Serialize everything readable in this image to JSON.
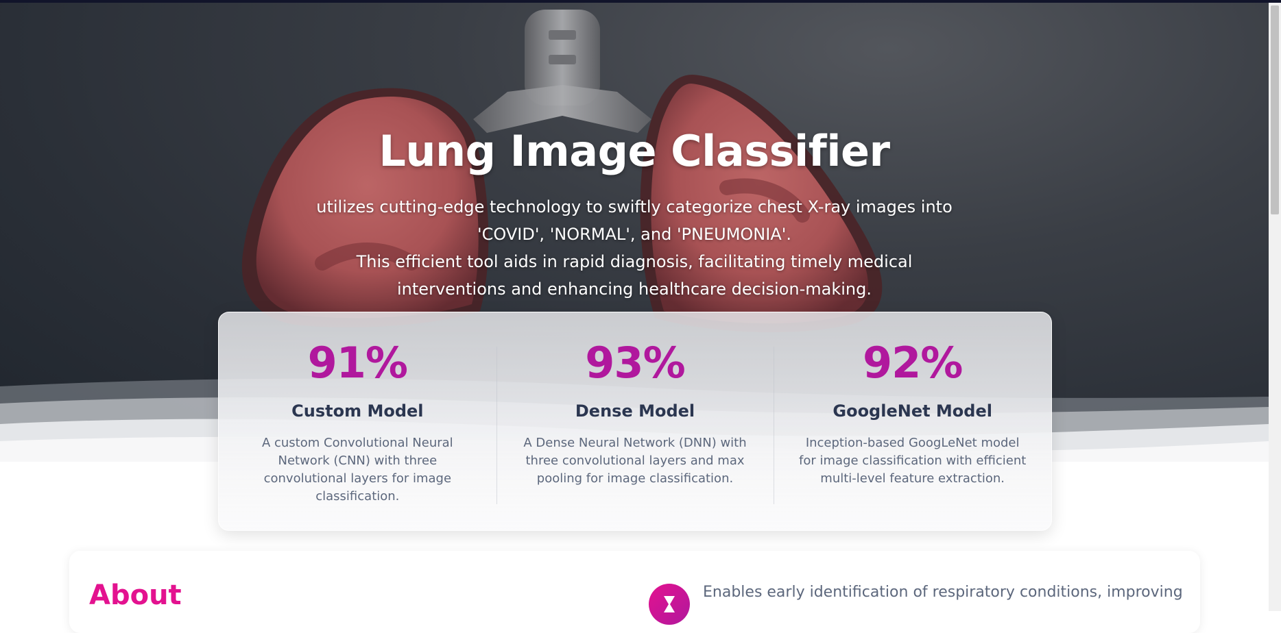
{
  "hero": {
    "title": "Lung Image Classifier",
    "description_lines": [
      "utilizes cutting-edge technology to swiftly categorize chest X-ray images into",
      "'COVID', 'NORMAL', and 'PNEUMONIA'.",
      "This efficient tool aids in rapid diagnosis, facilitating timely medical",
      "interventions and enhancing healthcare decision-making."
    ]
  },
  "stats": [
    {
      "value": "91%",
      "name": "Custom Model",
      "description": "A custom Convolutional Neural Network (CNN) with three convolutional layers for image classification."
    },
    {
      "value": "93%",
      "name": "Dense Model",
      "description": "A Dense Neural Network (DNN) with three convolutional layers and max pooling for image classification."
    },
    {
      "value": "92%",
      "name": "GoogleNet Model",
      "description": "Inception-based GoogLeNet model for image classification with efficient multi-level feature extraction."
    }
  ],
  "about": {
    "title": "About",
    "feature_text": "Enables early identification of respiratory conditions, improving",
    "feature_icon": "hourglass-icon"
  },
  "colors": {
    "accent": "#b0189d",
    "about_accent": "#e3128f",
    "heading": "#2b3650",
    "muted_text": "#5c677c",
    "hero_background": "#2a2f37"
  }
}
